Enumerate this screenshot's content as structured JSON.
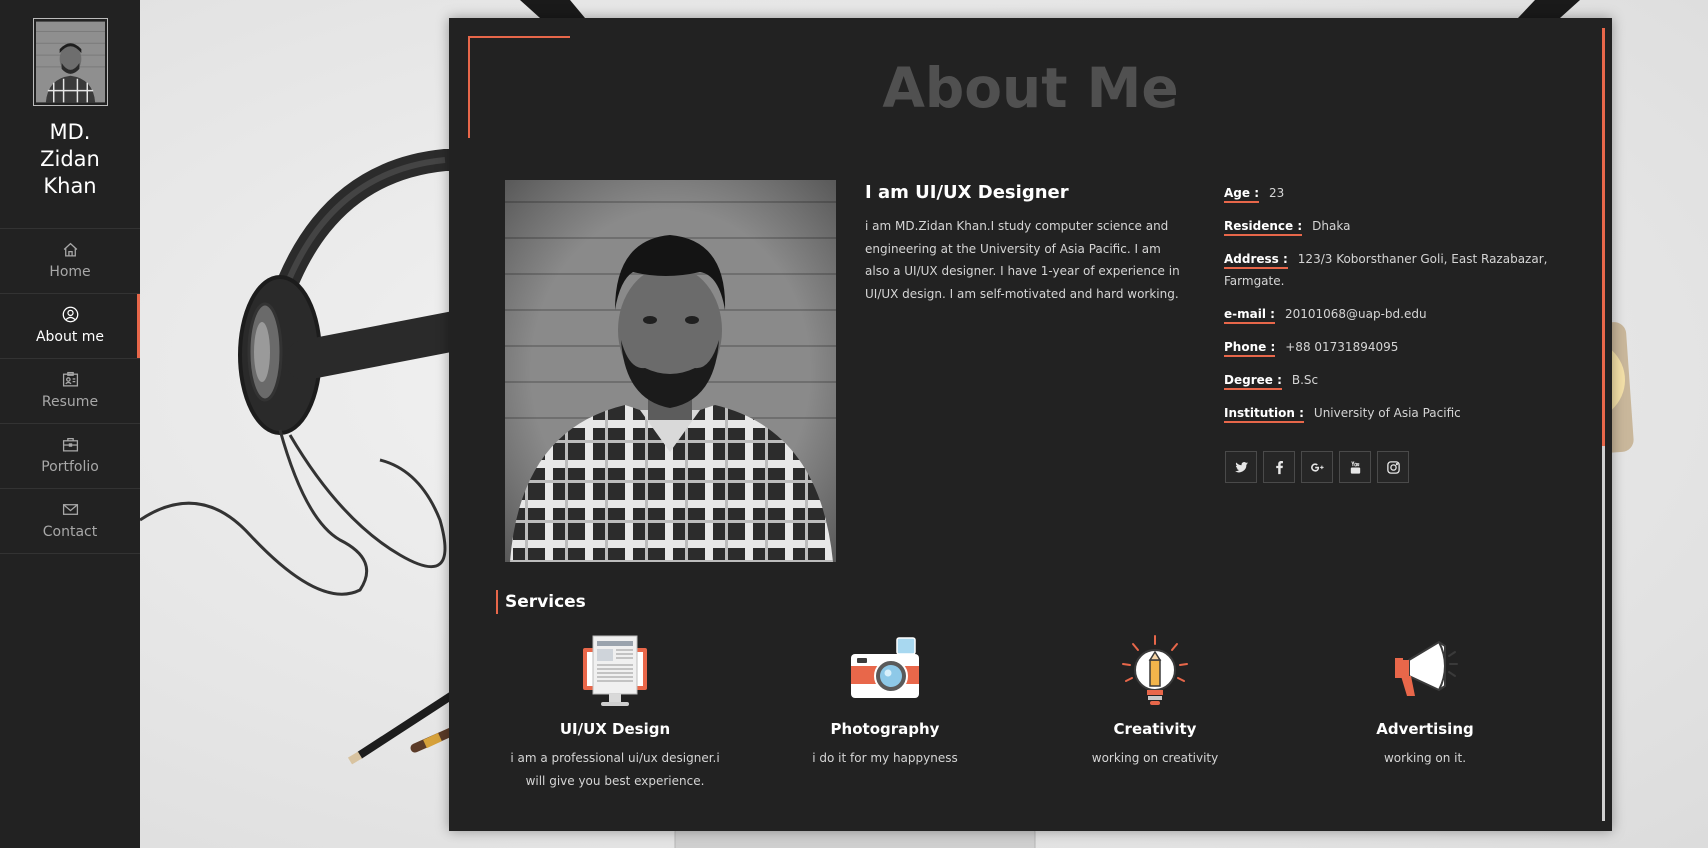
{
  "sidebar": {
    "owner_name": "MD. Zidan Khan",
    "nav": [
      {
        "label": "Home",
        "icon": "home-icon"
      },
      {
        "label": "About me",
        "icon": "user-circle-icon",
        "active": true
      },
      {
        "label": "Resume",
        "icon": "id-card-icon"
      },
      {
        "label": "Portfolio",
        "icon": "briefcase-icon"
      },
      {
        "label": "Contact",
        "icon": "envelope-icon"
      }
    ]
  },
  "about": {
    "page_title": "About Me",
    "intro_title": "I am UI/UX Designer",
    "intro_text": "i am MD.Zidan Khan.I study computer science and engineering at the University of Asia Pacific. I am also a UI/UX designer. I have 1-year of experience in UI/UX design. I am self-motivated and hard working.",
    "info": [
      {
        "key": "Age :",
        "value": "23"
      },
      {
        "key": "Residence :",
        "value": "Dhaka"
      },
      {
        "key": "Address :",
        "value": "123/3 Koborsthaner Goli, East Razabazar, Farmgate."
      },
      {
        "key": "e-mail :",
        "value": "20101068@uap-bd.edu"
      },
      {
        "key": "Phone :",
        "value": "+88 01731894095"
      },
      {
        "key": "Degree :",
        "value": "B.Sc"
      },
      {
        "key": "Institution :",
        "value": "University of Asia Pacific"
      }
    ],
    "social": [
      "twitter-icon",
      "facebook-icon",
      "google-plus-icon",
      "youtube-icon",
      "instagram-icon"
    ]
  },
  "services": {
    "title": "Services",
    "items": [
      {
        "name": "UI/UX Design",
        "desc": "i am a professional ui/ux designer.i will give you best experience.",
        "icon": "monitor-design-icon"
      },
      {
        "name": "Photography",
        "desc": "i do it for my happyness",
        "icon": "camera-icon"
      },
      {
        "name": "Creativity",
        "desc": "working on creativity",
        "icon": "lightbulb-pencil-icon"
      },
      {
        "name": "Advertising",
        "desc": "working on it.",
        "icon": "megaphone-icon"
      }
    ]
  },
  "colors": {
    "accent": "#e8674a",
    "panel_bg": "#222222",
    "sidebar_bg": "#222222",
    "title_gray": "#505050"
  }
}
